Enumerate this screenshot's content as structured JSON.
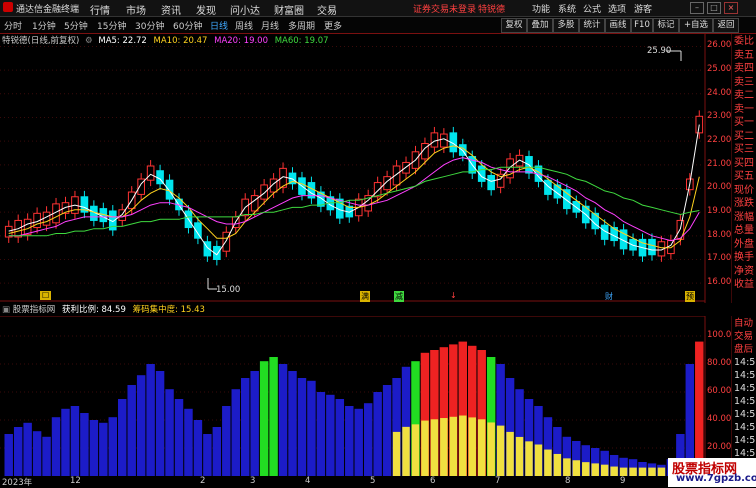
{
  "app": {
    "name": "通达信金融终端"
  },
  "menu": [
    "行情",
    "市场",
    "资讯",
    "发现",
    "问小达",
    "财富圈",
    "交易"
  ],
  "notice": "证券交易未登录",
  "stock_name": "特锐德",
  "right_menu": [
    "功能",
    "系统",
    "公式",
    "选项",
    "游客"
  ],
  "periods": [
    "分时",
    "1分钟",
    "5分钟",
    "15分钟",
    "30分钟",
    "60分钟",
    "日线",
    "周线",
    "月线",
    "多周期",
    "更多"
  ],
  "active_period": "日线",
  "toolbar_buttons": [
    "复权",
    "叠加",
    "多股",
    "统计",
    "画线",
    "F10",
    "标记",
    "+自选",
    "返回"
  ],
  "title": "特锐德(日线,前复权)",
  "ma": [
    {
      "label": "MA5: 22.72",
      "color": "#ffffff"
    },
    {
      "label": "MA10: 20.47",
      "color": "#ffd21e"
    },
    {
      "label": "MA20: 19.00",
      "color": "#ff40ff"
    },
    {
      "label": "MA60: 19.07",
      "color": "#3fd93f"
    }
  ],
  "y_axis": [
    "26.00",
    "25.00",
    "24.00",
    "23.00",
    "22.00",
    "21.00",
    "20.00",
    "19.00",
    "18.00",
    "17.00",
    "16.00"
  ],
  "high_label": "25.90",
  "low_label": "15.00",
  "events": [
    "☐",
    "满",
    "减",
    "↓",
    "财",
    "预"
  ],
  "side_labels": [
    "委比",
    "卖五",
    "卖四",
    "卖三",
    "卖二",
    "卖一",
    "买一",
    "买二",
    "买三",
    "买四",
    "买五",
    "现价",
    "涨跌",
    "涨幅",
    "总量",
    "外盘",
    "换手",
    "净资",
    "收益"
  ],
  "ind_title": "股票指标网",
  "ind_items": [
    {
      "label": "获利比例: 84.59",
      "color": "#ffffff"
    },
    {
      "label": "筹码集中度: 15.43",
      "color": "#ffd21e"
    }
  ],
  "ind_axis": [
    "100.0",
    "80.00",
    "60.00",
    "40.00",
    "20.00"
  ],
  "ind_side": [
    "自动",
    "交易",
    "盘后",
    "14:56",
    "14:56",
    "14:56",
    "14:56",
    "14:56",
    "14:56",
    "14:56",
    "14:56",
    "14:56"
  ],
  "x_labels": [
    "2023年",
    "12",
    "2",
    "3",
    "4",
    "5",
    "6",
    "7",
    "8",
    "9"
  ],
  "watermark": {
    "line1": "股票指标网",
    "line2": "www.7gpzb.com"
  },
  "colors": {
    "up": "#ff3333",
    "down": "#00e5ee",
    "bar_blue": "#1c1cc8",
    "bar_green": "#22dd22",
    "bar_red": "#ee2222",
    "bar_yellow": "#f0e040"
  },
  "chart_data": [
    {
      "type": "candlestick",
      "title": "特锐德(日线,前复权)",
      "ylim": [
        15.5,
        26.4
      ],
      "annotations": [
        "25.90",
        "15.00"
      ],
      "series": [
        {
          "name": "MA5",
          "values": [
            18.2,
            18.3,
            18.5,
            18.6,
            18.8,
            19.0,
            19.2,
            19.3,
            19.2,
            19.0,
            18.8,
            18.6,
            18.9,
            19.5,
            20.2,
            20.6,
            20.4,
            19.9,
            19.3,
            18.7,
            18.1,
            17.5,
            17.2,
            17.8,
            18.6,
            19.2,
            19.5,
            19.8,
            20.2,
            20.5,
            20.4,
            20.1,
            19.8,
            19.6,
            19.3,
            19.1,
            19.0,
            19.2,
            19.5,
            19.9,
            20.3,
            20.6,
            20.9,
            21.2,
            21.7,
            22.0,
            22.1,
            21.9,
            21.6,
            21.0,
            20.5,
            20.3,
            20.4,
            20.9,
            21.2,
            21.0,
            20.5,
            20.1,
            19.8,
            19.5,
            19.2,
            18.9,
            18.5,
            18.2,
            18.0,
            17.8,
            17.6,
            17.5,
            17.4,
            17.4,
            17.6,
            18.3,
            20.2,
            22.7
          ]
        },
        {
          "name": "MA10",
          "values": [
            18.1,
            18.2,
            18.3,
            18.5,
            18.6,
            18.8,
            19.0,
            19.1,
            19.1,
            19.0,
            18.9,
            18.8,
            18.8,
            19.1,
            19.5,
            19.8,
            20.0,
            19.9,
            19.6,
            19.2,
            18.7,
            18.3,
            17.9,
            17.9,
            18.1,
            18.6,
            19.0,
            19.4,
            19.8,
            20.1,
            20.3,
            20.2,
            20.0,
            19.8,
            19.6,
            19.4,
            19.2,
            19.2,
            19.3,
            19.5,
            19.8,
            20.1,
            20.4,
            20.7,
            21.1,
            21.5,
            21.7,
            21.8,
            21.7,
            21.4,
            21.0,
            20.7,
            20.5,
            20.6,
            20.8,
            20.9,
            20.7,
            20.4,
            20.1,
            19.8,
            19.5,
            19.2,
            18.9,
            18.6,
            18.3,
            18.1,
            17.9,
            17.7,
            17.6,
            17.5,
            17.5,
            17.8,
            18.8,
            20.5
          ]
        },
        {
          "name": "MA20",
          "values": [
            18.0,
            18.0,
            18.1,
            18.2,
            18.3,
            18.4,
            18.6,
            18.7,
            18.8,
            18.8,
            18.8,
            18.8,
            18.8,
            18.9,
            19.1,
            19.3,
            19.4,
            19.4,
            19.3,
            19.2,
            19.0,
            18.8,
            18.6,
            18.5,
            18.5,
            18.6,
            18.8,
            19.0,
            19.2,
            19.4,
            19.6,
            19.7,
            19.7,
            19.7,
            19.6,
            19.5,
            19.4,
            19.3,
            19.3,
            19.4,
            19.5,
            19.7,
            19.9,
            20.1,
            20.4,
            20.7,
            21.0,
            21.2,
            21.3,
            21.2,
            21.1,
            20.9,
            20.8,
            20.7,
            20.7,
            20.7,
            20.6,
            20.5,
            20.3,
            20.1,
            19.9,
            19.6,
            19.4,
            19.1,
            18.9,
            18.6,
            18.4,
            18.2,
            18.0,
            17.9,
            17.8,
            17.9,
            18.3,
            19.0
          ]
        },
        {
          "name": "MA60",
          "values": [
            18.0,
            18.0,
            18.0,
            18.0,
            18.0,
            18.1,
            18.1,
            18.2,
            18.2,
            18.3,
            18.3,
            18.4,
            18.4,
            18.5,
            18.6,
            18.6,
            18.7,
            18.7,
            18.7,
            18.8,
            18.8,
            18.8,
            18.8,
            18.8,
            18.8,
            18.9,
            18.9,
            19.0,
            19.0,
            19.1,
            19.2,
            19.2,
            19.3,
            19.3,
            19.4,
            19.4,
            19.5,
            19.5,
            19.6,
            19.7,
            19.8,
            19.9,
            20.0,
            20.1,
            20.3,
            20.4,
            20.5,
            20.6,
            20.7,
            20.7,
            20.8,
            20.8,
            20.9,
            20.9,
            20.9,
            20.9,
            20.9,
            20.8,
            20.7,
            20.6,
            20.4,
            20.3,
            20.1,
            19.9,
            19.8,
            19.6,
            19.5,
            19.3,
            19.2,
            19.1,
            19.0,
            18.9,
            19.0,
            19.07
          ]
        }
      ]
    },
    {
      "type": "bar",
      "title": "股票指标网",
      "ylim": [
        0,
        110
      ],
      "series": [
        {
          "name": "获利比例",
          "values": [
            30,
            35,
            38,
            32,
            28,
            42,
            48,
            50,
            45,
            40,
            38,
            42,
            55,
            65,
            72,
            80,
            75,
            62,
            55,
            48,
            40,
            30,
            35,
            50,
            62,
            70,
            75,
            82,
            85,
            80,
            75,
            70,
            68,
            60,
            58,
            55,
            50,
            48,
            52,
            60,
            65,
            70,
            78,
            82,
            88,
            90,
            92,
            94,
            96,
            93,
            90,
            85,
            80,
            70,
            62,
            55,
            50,
            42,
            35,
            28,
            25,
            22,
            20,
            18,
            15,
            13,
            12,
            10,
            9,
            8,
            12,
            30,
            80,
            96
          ]
        }
      ]
    }
  ]
}
